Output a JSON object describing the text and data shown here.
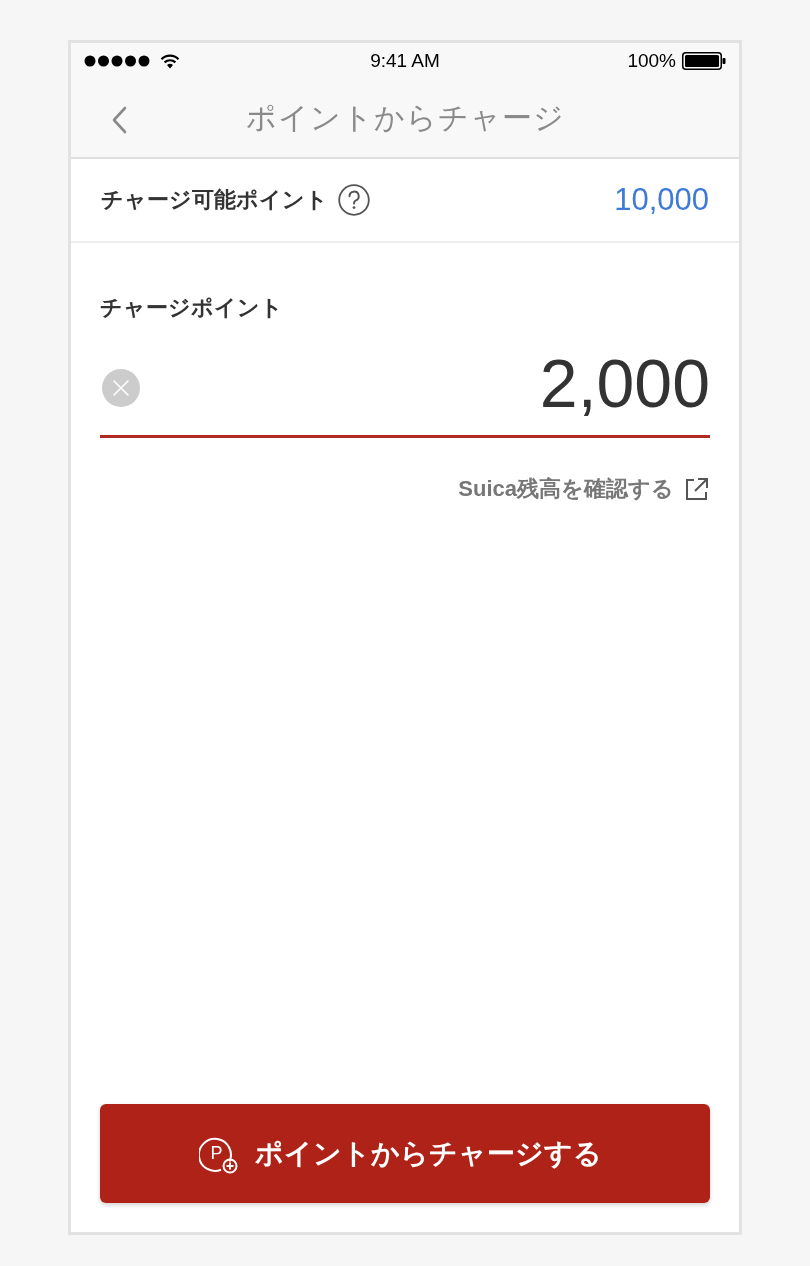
{
  "status_bar": {
    "time": "9:41 AM",
    "battery": "100%"
  },
  "nav_bar": {
    "title": "ポイントからチャージ"
  },
  "available_points": {
    "label": "チャージ可能ポイント",
    "value": "10,000"
  },
  "charge_field": {
    "label": "チャージポイント",
    "value": "2,000"
  },
  "balance_link": {
    "label": "Suica残高を確認する"
  },
  "charge_button": {
    "icon_letter": "P",
    "label": "ポイントからチャージする"
  }
}
